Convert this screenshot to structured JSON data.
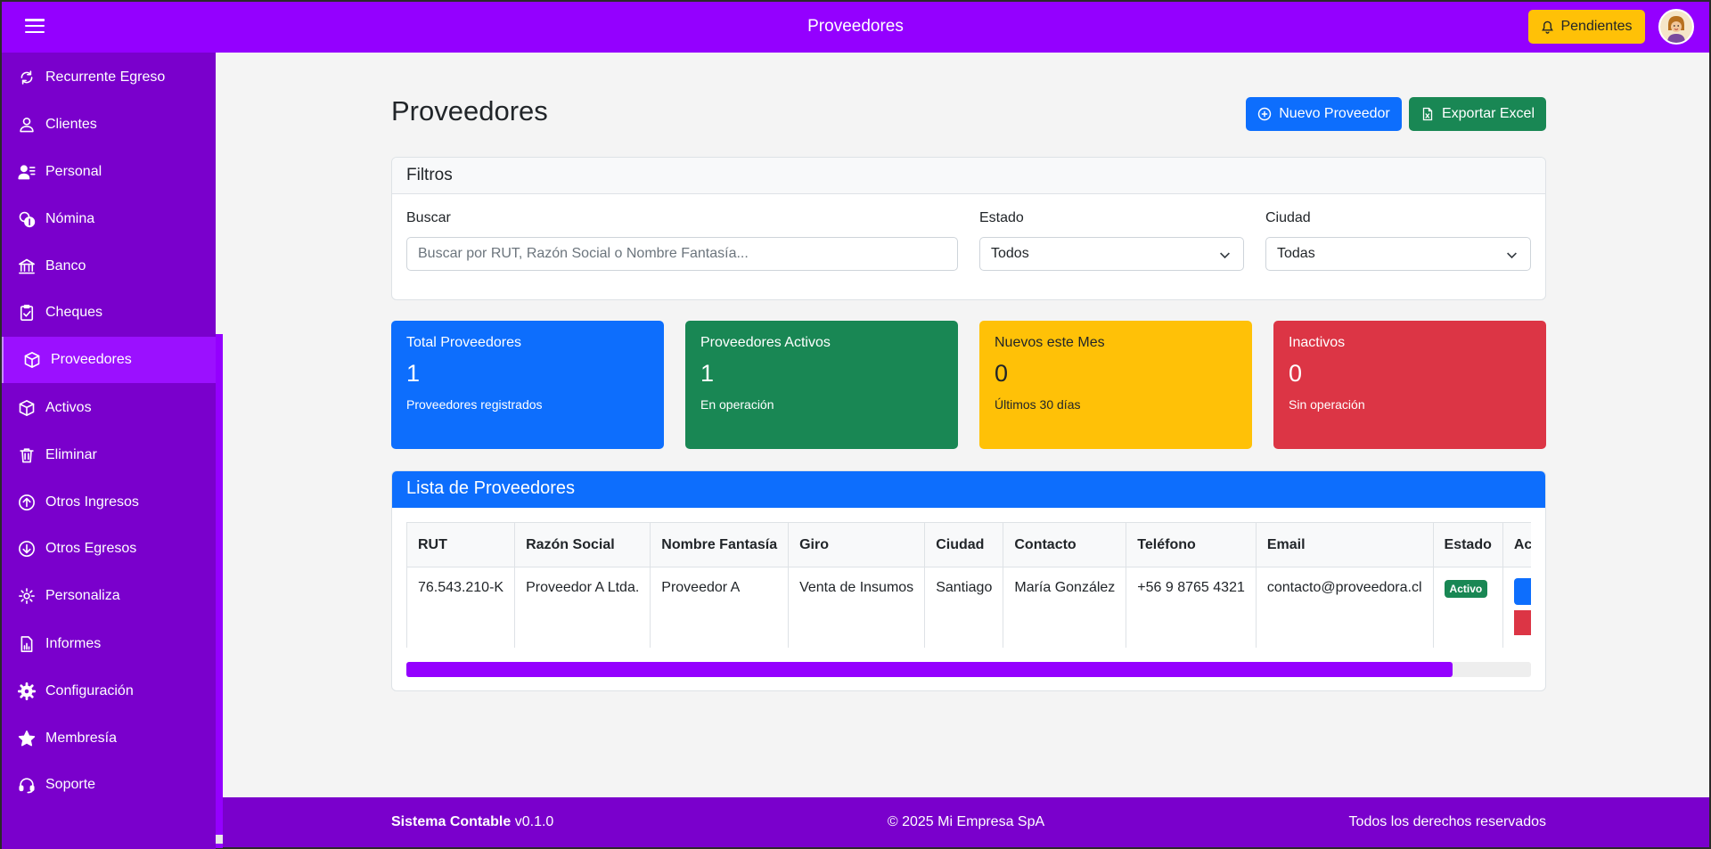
{
  "topbar": {
    "title": "Proveedores",
    "pending_label": "Pendientes"
  },
  "sidebar": {
    "items": [
      {
        "label": "Recurrente Egreso",
        "icon": "refresh-icon"
      },
      {
        "label": "Clientes",
        "icon": "person-icon"
      },
      {
        "label": "Personal",
        "icon": "person-lines-icon"
      },
      {
        "label": "Nómina",
        "icon": "coins-icon"
      },
      {
        "label": "Banco",
        "icon": "bank-icon"
      },
      {
        "label": "Cheques",
        "icon": "clipboard-check-icon"
      },
      {
        "label": "Proveedores",
        "icon": "box-icon",
        "active": true
      },
      {
        "label": "Activos",
        "icon": "box-icon"
      },
      {
        "label": "Eliminar",
        "icon": "trash-icon"
      },
      {
        "label": "Otros Ingresos",
        "icon": "arrow-up-circle-icon"
      },
      {
        "label": "Otros Egresos",
        "icon": "arrow-down-circle-icon"
      },
      {
        "label": "Personaliza",
        "icon": "gear-icon"
      },
      {
        "label": "Informes",
        "icon": "file-chart-icon"
      },
      {
        "label": "Configuración",
        "icon": "gear-fill-icon"
      },
      {
        "label": "Membresía",
        "icon": "star-icon"
      },
      {
        "label": "Soporte",
        "icon": "headset-icon"
      }
    ]
  },
  "page": {
    "title": "Proveedores",
    "new_button": "Nuevo Proveedor",
    "export_button": "Exportar Excel"
  },
  "filters": {
    "title": "Filtros",
    "search_label": "Buscar",
    "search_placeholder": "Buscar por RUT, Razón Social o Nombre Fantasía...",
    "search_value": "",
    "estado_label": "Estado",
    "estado_value": "Todos",
    "ciudad_label": "Ciudad",
    "ciudad_value": "Todas"
  },
  "stats": [
    {
      "title": "Total Proveedores",
      "value": "1",
      "sub": "Proveedores registrados",
      "color": "#0d6efd"
    },
    {
      "title": "Proveedores Activos",
      "value": "1",
      "sub": "En operación",
      "color": "#198754"
    },
    {
      "title": "Nuevos este Mes",
      "value": "0",
      "sub": "Últimos 30 días",
      "color": "#ffc107"
    },
    {
      "title": "Inactivos",
      "value": "0",
      "sub": "Sin operación",
      "color": "#dc3545"
    }
  ],
  "list": {
    "title": "Lista de Proveedores",
    "columns": [
      "RUT",
      "Razón Social",
      "Nombre Fantasía",
      "Giro",
      "Ciudad",
      "Contacto",
      "Teléfono",
      "Email",
      "Estado",
      "Ac"
    ],
    "rows": [
      {
        "rut": "76.543.210-K",
        "razon_social": "Proveedor A Ltda.",
        "nombre_fantasia": "Proveedor A",
        "giro": "Venta de Insumos",
        "ciudad": "Santiago",
        "contacto": "María González",
        "telefono": "+56 9 8765 4321",
        "email": "contacto@proveedora.cl",
        "estado": "Activo"
      }
    ],
    "scroll_position_fraction": 0.93
  },
  "footer": {
    "app_name": "Sistema Contable",
    "version": "v0.1.0",
    "copyright": "© 2025 Mi Empresa SpA",
    "rights": "Todos los derechos reservados"
  },
  "colors": {
    "brand": "#9400ff",
    "sidebar": "#7a00cc",
    "primary": "#0d6efd",
    "success": "#198754",
    "warning": "#ffc107",
    "danger": "#dc3545"
  }
}
